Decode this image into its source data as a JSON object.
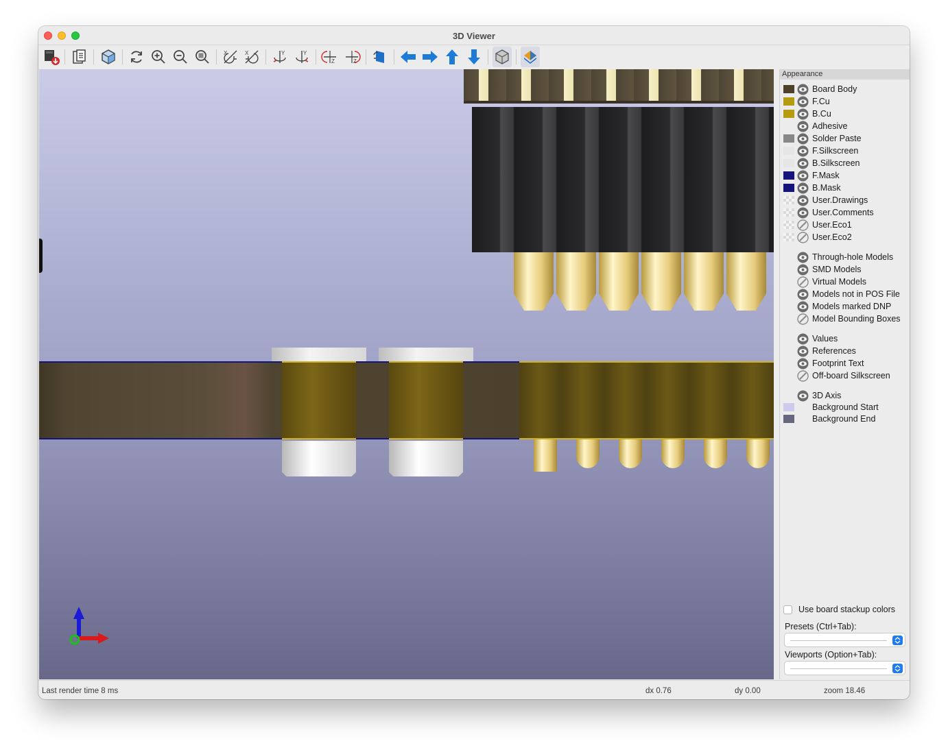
{
  "window": {
    "title": "3D Viewer"
  },
  "toolbar": {
    "buttons": [
      {
        "icon": "export-image-icon"
      },
      {
        "icon": "copy-to-clipboard-icon"
      },
      {
        "icon": "raytracing-cube-icon"
      },
      {
        "icon": "reload-icon"
      },
      {
        "icon": "zoom-in-icon"
      },
      {
        "icon": "zoom-out-icon"
      },
      {
        "icon": "zoom-fit-icon"
      },
      {
        "icon": "rotate-x-cw-icon"
      },
      {
        "icon": "rotate-x-ccw-icon"
      },
      {
        "icon": "rotate-y-cw-icon"
      },
      {
        "icon": "rotate-y-ccw-icon"
      },
      {
        "icon": "rotate-z-cw-icon"
      },
      {
        "icon": "rotate-z-ccw-icon"
      },
      {
        "icon": "flip-board-icon"
      },
      {
        "icon": "move-left-icon"
      },
      {
        "icon": "move-right-icon"
      },
      {
        "icon": "move-up-icon"
      },
      {
        "icon": "move-down-icon"
      },
      {
        "icon": "orthographic-icon"
      },
      {
        "icon": "appearance-layers-icon"
      }
    ]
  },
  "panel": {
    "title": "Appearance",
    "layers": [
      {
        "name": "Board Body",
        "color": "#4d412c",
        "visible": true
      },
      {
        "name": "F.Cu",
        "color": "#b59c0f",
        "visible": true
      },
      {
        "name": "B.Cu",
        "color": "#b59c0f",
        "visible": true
      },
      {
        "name": "Adhesive",
        "color": "",
        "visible": true
      },
      {
        "name": "Solder Paste",
        "color": "#888888",
        "visible": true
      },
      {
        "name": "F.Silkscreen",
        "color": "#e6e6e6",
        "visible": true
      },
      {
        "name": "B.Silkscreen",
        "color": "#e6e6e6",
        "visible": true
      },
      {
        "name": "F.Mask",
        "color": "#14147a",
        "visible": true
      },
      {
        "name": "B.Mask",
        "color": "#14147a",
        "visible": true
      },
      {
        "name": "User.Drawings",
        "color": "checker",
        "visible": true
      },
      {
        "name": "User.Comments",
        "color": "checker",
        "visible": true
      },
      {
        "name": "User.Eco1",
        "color": "checker",
        "visible": false
      },
      {
        "name": "User.Eco2",
        "color": "checker",
        "visible": false
      }
    ],
    "models": [
      {
        "name": "Through-hole Models",
        "visible": true
      },
      {
        "name": "SMD Models",
        "visible": true
      },
      {
        "name": "Virtual Models",
        "visible": false
      },
      {
        "name": "Models not in POS File",
        "visible": true
      },
      {
        "name": "Models marked DNP",
        "visible": true
      },
      {
        "name": "Model Bounding Boxes",
        "visible": false
      }
    ],
    "texts": [
      {
        "name": "Values",
        "visible": true
      },
      {
        "name": "References",
        "visible": true
      },
      {
        "name": "Footprint Text",
        "visible": true
      },
      {
        "name": "Off-board Silkscreen",
        "visible": false
      }
    ],
    "axis": {
      "name": "3D Axis",
      "visible": true
    },
    "backgrounds": [
      {
        "name": "Background Start",
        "color": "#ccccea"
      },
      {
        "name": "Background End",
        "color": "#66667e"
      }
    ],
    "stackup_checkbox": {
      "label": "Use board stackup colors",
      "checked": false
    },
    "presets_label": "Presets (Ctrl+Tab):",
    "viewports_label": "Viewports (Option+Tab):"
  },
  "status": {
    "render": "Last render time 8 ms",
    "dx": "dx 0.76",
    "dy": "dy 0.00",
    "zoom": "zoom 18.46"
  }
}
